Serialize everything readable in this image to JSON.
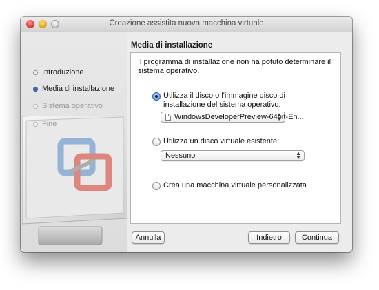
{
  "window": {
    "title": "Creazione assistita nuova macchina virtuale"
  },
  "sidebar": {
    "steps": [
      {
        "label": "Introduzione",
        "state": "done"
      },
      {
        "label": "Media di installazione",
        "state": "current"
      },
      {
        "label": "Sistema operativo",
        "state": "disabled"
      },
      {
        "label": "Fine",
        "state": "disabled"
      }
    ]
  },
  "main": {
    "header": "Media di installazione",
    "description": "Il programma di installazione non ha potuto determinare il sistema operativo.",
    "options": [
      {
        "label": "Utilizza il disco o l'immagine disco di installazione del sistema operativo:",
        "selected": true
      },
      {
        "label": "Utilizza un disco virtuale esistente:",
        "selected": false
      },
      {
        "label": "Crea una macchina virtuale personalizzata",
        "selected": false
      }
    ],
    "disk_image_select": {
      "value": "WindowsDeveloperPreview-64bit-En...",
      "icon": "document-icon"
    },
    "virtual_disk_select": {
      "value": "Nessuno"
    }
  },
  "footer": {
    "cancel_label": "Annulla",
    "back_label": "Indietro",
    "continue_label": "Continua"
  },
  "colors": {
    "accent": "#3b6fb6",
    "window_bg": "#ececec",
    "logo_blue": "#6f9fcf",
    "logo_red": "#d9534f"
  }
}
